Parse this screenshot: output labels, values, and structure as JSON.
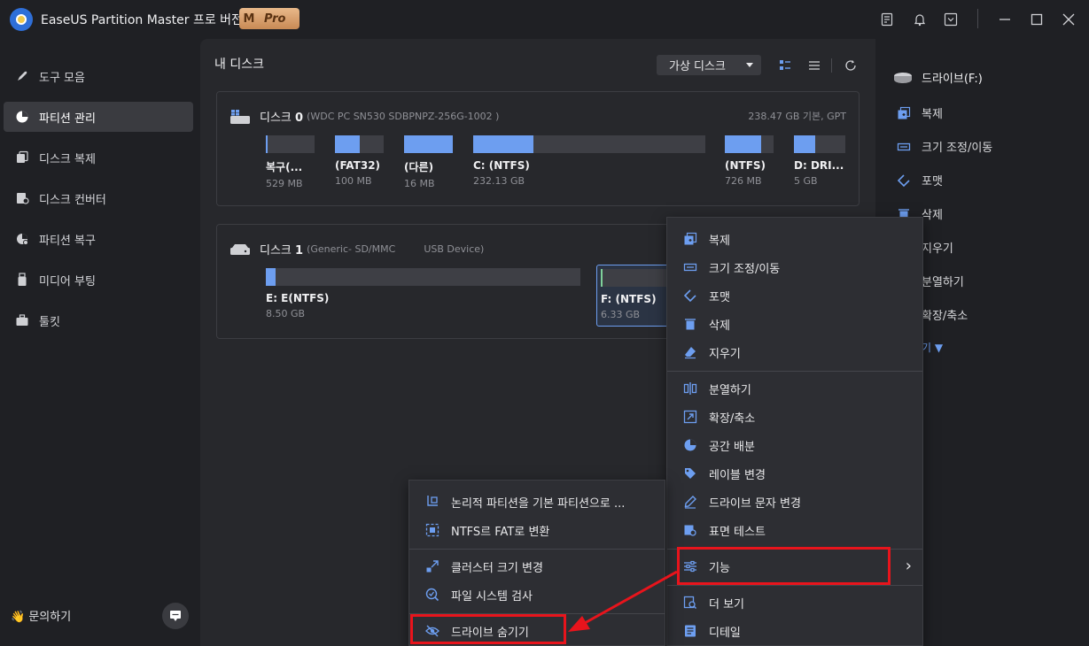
{
  "app": {
    "title": "EaseUS Partition Master 프로 버전",
    "badge_m": "M",
    "badge_pro": "Pro"
  },
  "sidebar": {
    "items": [
      {
        "label": "도구 모음",
        "icon": "rocket-icon"
      },
      {
        "label": "파티션 관리",
        "icon": "pie-chart-icon"
      },
      {
        "label": "디스크 복제",
        "icon": "disk-clone-icon"
      },
      {
        "label": "디스크 컨버터",
        "icon": "disk-converter-icon"
      },
      {
        "label": "파티션 복구",
        "icon": "partition-recovery-icon"
      },
      {
        "label": "미디어 부팅",
        "icon": "usb-icon"
      },
      {
        "label": "툴킷",
        "icon": "toolkit-icon"
      }
    ],
    "help_label": "👋 문의하기"
  },
  "main": {
    "title": "내 디스크",
    "virtual_disk_label": "가상 디스크"
  },
  "disk0": {
    "name": "디스크 ",
    "number": "0",
    "model": "(WDC PC SN530 SDBPNPZ-256G-1002 )",
    "meta": "238.47 GB 기본, GPT",
    "partitions": [
      {
        "label": "복구(...",
        "size": "529 MB",
        "used": 0.03
      },
      {
        "label": "(FAT32)",
        "size": "100 MB",
        "used": 0.5
      },
      {
        "label": "(다른)",
        "size": "16 MB",
        "used": 1.0
      },
      {
        "label": "C: (NTFS)",
        "size": "232.13 GB",
        "used": 0.26
      },
      {
        "label": "(NTFS)",
        "size": "726 MB",
        "used": 0.75
      },
      {
        "label": "D: DRI...",
        "size": "5 GB",
        "used": 0.42
      }
    ]
  },
  "disk1": {
    "name": "디스크 ",
    "number": "1",
    "model": "(Generic- SD/MMC",
    "model2": "USB Device)",
    "partitions": [
      {
        "label": "E: E(NTFS)",
        "size": "8.50 GB",
        "used": 0.01
      },
      {
        "label": "F: (NTFS)",
        "size": "6.33 GB",
        "used": 0.02
      }
    ]
  },
  "right_panel": {
    "drive": "드라이브(F:)",
    "items": [
      "복제",
      "크기 조정/이동",
      "포맷",
      "삭제",
      "지우기",
      "분열하기",
      "확장/축소"
    ],
    "more": "기 ▼"
  },
  "context_menu": {
    "group1": [
      "복제",
      "크기 조정/이동",
      "포맷",
      "삭제",
      "지우기"
    ],
    "group2": [
      "분열하기",
      "확장/축소",
      "공간 배분",
      "레이블 변경",
      "드라이브 문자 변경",
      "표면 테스트"
    ],
    "function": "기능",
    "function_arrow": "›",
    "group4": [
      "더 보기",
      "디테일"
    ]
  },
  "submenu": {
    "group1": [
      "논리적 파티션을 기본 파티션으로 ...",
      "NTFS르 FAT로 변환"
    ],
    "group2": [
      "클러스터 크기 변경",
      "파일 시스템 검사"
    ],
    "hide_drive": "드라이브 숨기기"
  },
  "colors": {
    "accent": "#6d9ef0",
    "highlight": "#e8141c",
    "background": "#1f2024",
    "panel": "#27282c",
    "menu": "#2d2e33"
  }
}
